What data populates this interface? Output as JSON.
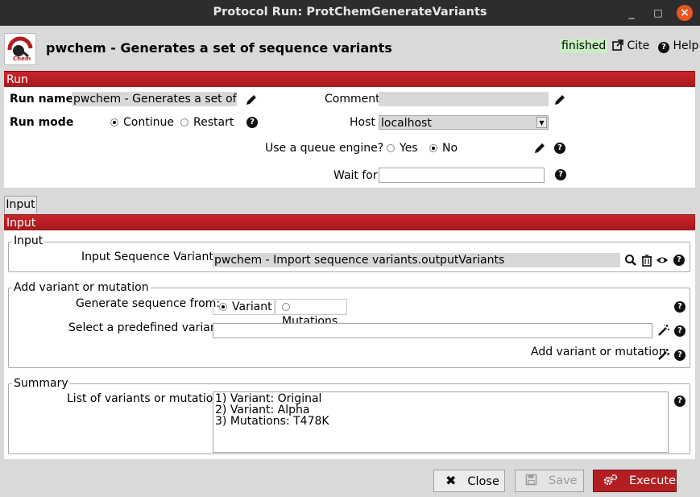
{
  "window": {
    "title": "Protocol Run: ProtChemGenerateVariants",
    "minimize": "_",
    "maximize": "□",
    "close": "×"
  },
  "header": {
    "logo_text": "Chem",
    "protocol_title": "pwchem - Generates a set of sequence variants",
    "status": "finished",
    "cite_label": "Cite",
    "help_label": "Help"
  },
  "run": {
    "section_label": "Run",
    "run_name_label": "Run name",
    "run_name_value": "pwchem - Generates a set of se",
    "comment_label": "Comment",
    "comment_value": "",
    "run_mode_label": "Run mode",
    "continue_label": "Continue",
    "restart_label": "Restart",
    "host_label": "Host",
    "host_value": "localhost",
    "queue_label": "Use a queue engine?",
    "yes_label": "Yes",
    "no_label": "No",
    "wait_for_label": "Wait for",
    "wait_for_value": ""
  },
  "tabs": [
    {
      "label": "Input"
    }
  ],
  "input": {
    "section_label": "Input",
    "group_input_label": "Input",
    "input_seq_label": "Input Sequence Variants:",
    "input_seq_value": "pwchem - Import sequence variants.outputVariants",
    "group_add_label": "Add variant or mutation",
    "generate_from_label": "Generate sequence from:",
    "variant_option": "Variant",
    "mutations_option": "Mutations",
    "select_predefined_label": "Select a predefined variant:",
    "select_predefined_value": "",
    "add_variant_label": "Add variant or mutation:",
    "group_summary_label": "Summary",
    "list_label": "List of variants or mutations:",
    "list_items": [
      "1) Variant: Original",
      "2) Variant: Alpha",
      "3) Mutations: T478K"
    ]
  },
  "footer": {
    "close_label": "Close",
    "save_label": "Save",
    "execute_label": "Execute"
  },
  "colors": {
    "accent_red": "#b31e23",
    "status_bg": "#c8f0c0",
    "titlebar": "#2d2d2d",
    "close_circle": "#e95420"
  }
}
